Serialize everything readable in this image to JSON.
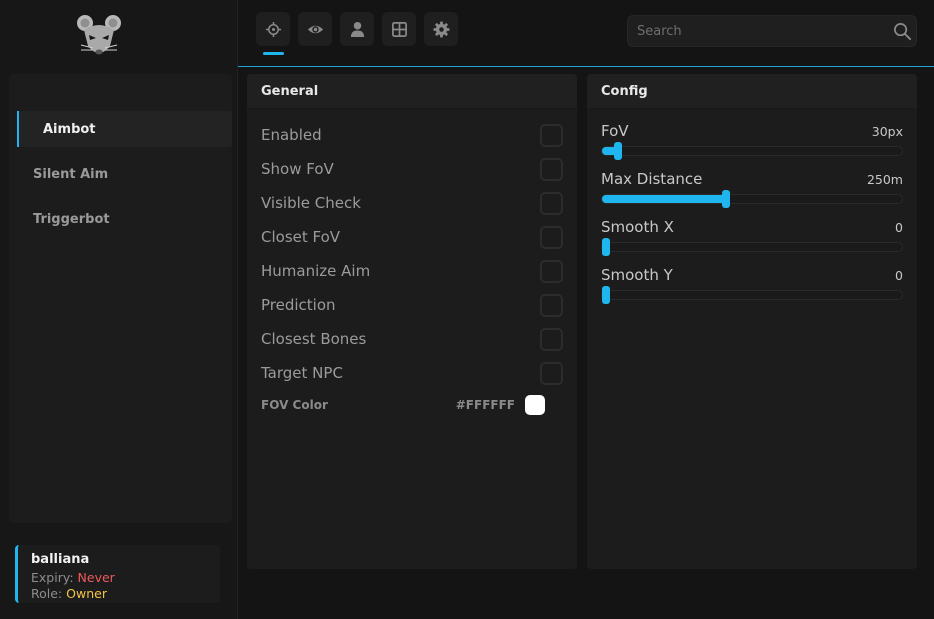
{
  "brand": {
    "logo_icon": "mouse-icon"
  },
  "sidebar": {
    "items": [
      {
        "label": "Aimbot",
        "active": true
      },
      {
        "label": "Silent Aim",
        "active": false
      },
      {
        "label": "Triggerbot",
        "active": false
      }
    ]
  },
  "user": {
    "name": "balliana",
    "expiry_label": "Expiry:",
    "expiry_value": "Never",
    "role_label": "Role:",
    "role_value": "Owner"
  },
  "tabs": [
    {
      "icon": "crosshair-icon",
      "active": true
    },
    {
      "icon": "eye-icon",
      "active": false
    },
    {
      "icon": "user-icon",
      "active": false
    },
    {
      "icon": "grid-icon",
      "active": false
    },
    {
      "icon": "gear-icon",
      "active": false
    }
  ],
  "search": {
    "placeholder": "Search",
    "value": ""
  },
  "general": {
    "title": "General",
    "checks": [
      {
        "label": "Enabled",
        "checked": false
      },
      {
        "label": "Show FoV",
        "checked": false
      },
      {
        "label": "Visible Check",
        "checked": false
      },
      {
        "label": "Closet FoV",
        "checked": false
      },
      {
        "label": "Humanize Aim",
        "checked": false
      },
      {
        "label": "Prediction",
        "checked": false
      },
      {
        "label": "Closest Bones",
        "checked": false
      },
      {
        "label": "Target NPC",
        "checked": false
      }
    ],
    "fov_color": {
      "label": "FOV Color",
      "hex": "#FFFFFF"
    }
  },
  "config": {
    "title": "Config",
    "sliders": [
      {
        "label": "FoV",
        "value_text": "30px",
        "fraction": 0.04
      },
      {
        "label": "Max Distance",
        "value_text": "250m",
        "fraction": 0.41
      },
      {
        "label": "Smooth X",
        "value_text": "0",
        "fraction": 0.0
      },
      {
        "label": "Smooth Y",
        "value_text": "0",
        "fraction": 0.0
      }
    ]
  },
  "colors": {
    "accent": "#1fb6f0",
    "never": "#ef5a5a",
    "owner": "#f2c343"
  }
}
